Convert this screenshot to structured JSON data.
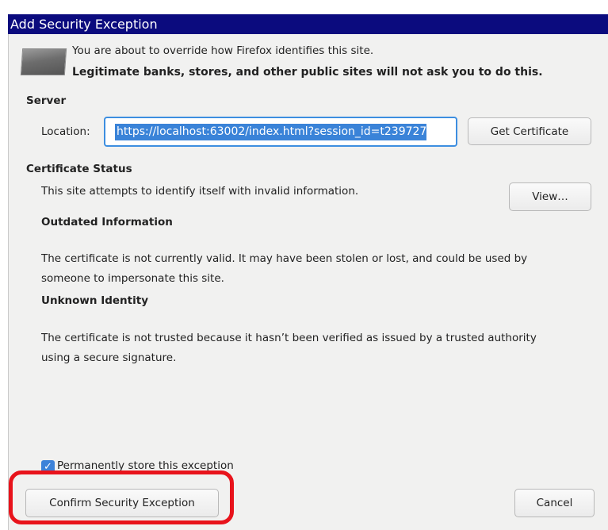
{
  "window": {
    "title": "Add Security Exception"
  },
  "intro": {
    "line1": "You are about to override how Firefox identifies this site.",
    "line2": "Legitimate banks, stores, and other public sites will not ask you to do this.",
    "icon": "warning-image-icon"
  },
  "server": {
    "heading": "Server",
    "location_label": "Location:",
    "location_value": "https://localhost:63002/index.html?session_id=t239727",
    "get_certificate_button": "Get Certificate"
  },
  "certificate_status": {
    "heading": "Certificate Status",
    "summary": "This site attempts to identify itself with invalid information.",
    "view_button": "View…",
    "outdated": {
      "heading": "Outdated Information",
      "line1": "The certificate is not currently valid. It may have been stolen or lost, and could be used by",
      "line2": "someone to impersonate this site."
    },
    "unknown": {
      "heading": "Unknown Identity",
      "line1": "The certificate is not trusted because it hasn’t been verified as issued by a trusted authority",
      "line2": "using a secure signature."
    }
  },
  "permanent_checkbox": {
    "label": "Permanently store this exception",
    "checked": true
  },
  "buttons": {
    "confirm": "Confirm Security Exception",
    "cancel": "Cancel"
  },
  "annotation": {
    "highlight_color": "#e8131b"
  }
}
